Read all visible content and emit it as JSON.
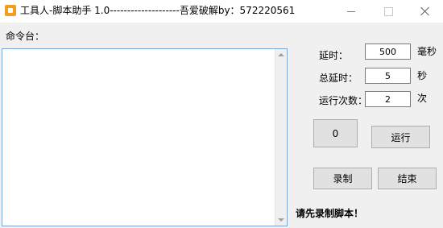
{
  "window": {
    "title": "工具人-脚本助手 1.0--------------------吾爱破解by：572220561"
  },
  "console": {
    "label": "命令台：",
    "content": ""
  },
  "settings": {
    "delay_label": "延时：",
    "delay_value": "500",
    "delay_unit": "毫秒",
    "total_delay_label": "总延时：",
    "total_delay_value": "5",
    "total_delay_unit": "秒",
    "run_count_label": "运行次数：",
    "run_count_value": "2",
    "run_count_unit": "次"
  },
  "buttons": {
    "counter_label": "0",
    "run_label": "运行",
    "record_label": "录制",
    "end_label": "结束"
  },
  "status": {
    "message": "请先录制脚本！"
  }
}
